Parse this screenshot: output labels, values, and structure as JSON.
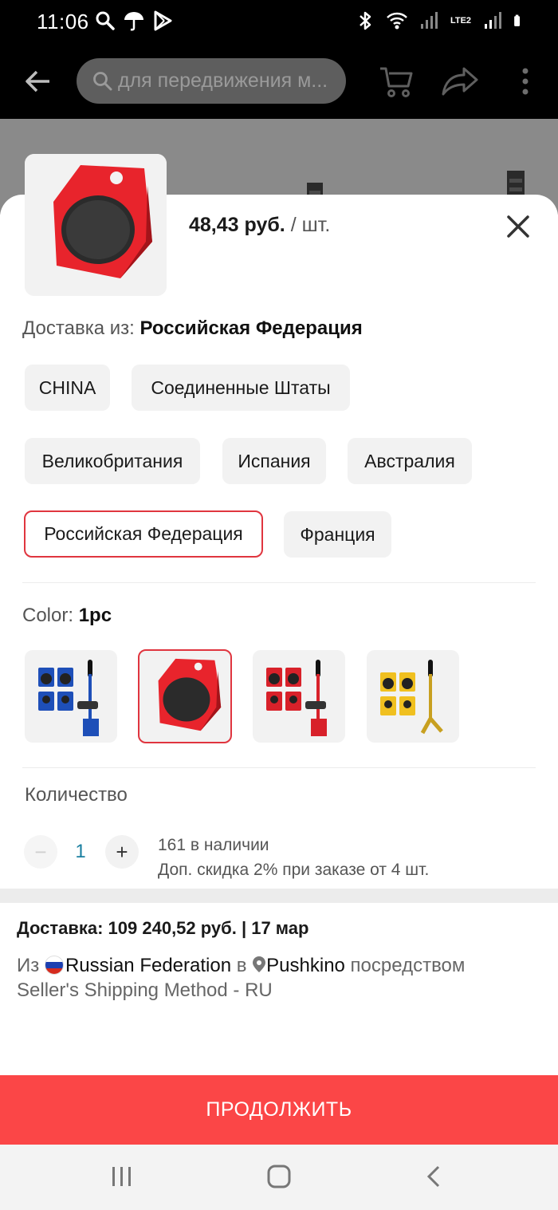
{
  "status_bar": {
    "time": "11:06",
    "network": "LTE2"
  },
  "app_bar": {
    "search_text": "для передвижения м..."
  },
  "sheet": {
    "price": "48,43 руб.",
    "unit": " / шт.",
    "ship_from_label": "Доставка из:",
    "ship_from_value": "Российская Федерация",
    "countries": [
      "CHINA",
      "Соединенные Штаты",
      "Великобритания",
      "Испания",
      "Австралия",
      "Российская Федерация",
      "Франция"
    ],
    "selected_country": "Российская Федерация",
    "color_label": "Color:",
    "color_value": "1pc",
    "color_options": [
      "blue-set",
      "1pc-red",
      "red-set",
      "yellow-set"
    ],
    "selected_color": "1pc-red",
    "quantity_label": "Количество",
    "quantity_minus": "−",
    "quantity_value": "1",
    "quantity_plus": "+",
    "stock": "161 в наличии",
    "discount": "Доп. скидка 2% при заказе от 4 шт."
  },
  "delivery": {
    "title": "Доставка: 109 240,52 руб. | 17 мар",
    "from_prefix": "Из",
    "from_country": "Russian Federation",
    "to_prefix": " в ",
    "to_city": "Pushkino",
    "via": " посредством Seller's Shipping Method - RU"
  },
  "continue_button": "ПРОДОЛЖИТЬ",
  "colors": {
    "accent": "#fb4647",
    "selected_border": "#e0353f",
    "chip_bg": "#f2f2f2",
    "quantity_value": "#1a7fa0"
  }
}
